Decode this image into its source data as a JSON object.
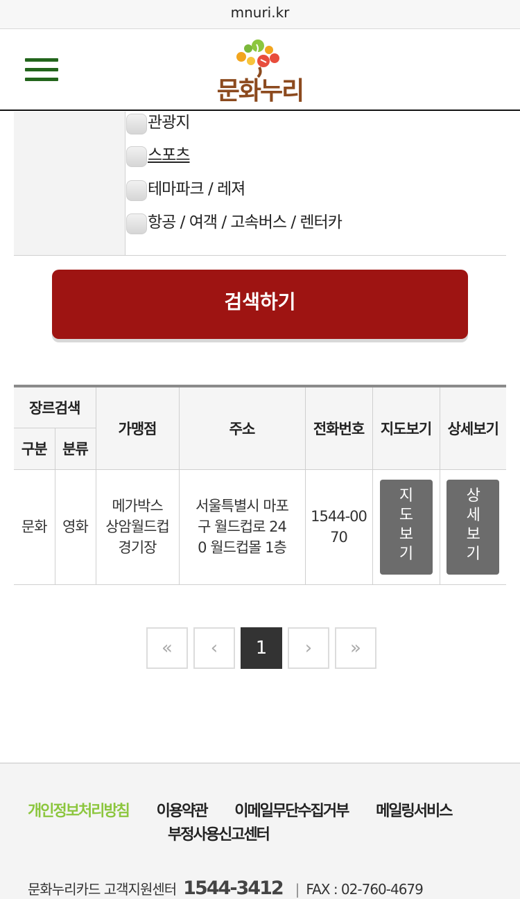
{
  "browser": {
    "url": "mnuri.kr"
  },
  "header": {
    "logo_text": "문화누리"
  },
  "filters": {
    "options": [
      {
        "label": "관광지"
      },
      {
        "label": "스포츠"
      },
      {
        "label": "테마파크 / 레져"
      },
      {
        "label": "항공 / 여객 / 고속버스 / 렌터카"
      }
    ]
  },
  "search_button": {
    "label": "검색하기"
  },
  "table": {
    "headers": {
      "genre_search": "장르검색",
      "category": "구분",
      "type": "분류",
      "store": "가맹점",
      "address": "주소",
      "phone": "전화번호",
      "map": "지도보기",
      "detail": "상세보기"
    },
    "rows": [
      {
        "category": "문화",
        "type": "영화",
        "store_lines": [
          "메가박스",
          "상암월드컵",
          "경기장"
        ],
        "address_lines": [
          "서울특별시 마포",
          "구 월드컵로 24",
          "0 월드컵몰 1층"
        ],
        "phone_lines": [
          "1544-00",
          "70"
        ],
        "map_btn": [
          "지",
          "도",
          "보",
          "기"
        ],
        "detail_btn": [
          "상",
          "세",
          "보",
          "기"
        ]
      }
    ]
  },
  "pagination": {
    "first": "«",
    "prev": "‹",
    "current": "1",
    "next": "›",
    "last": "»"
  },
  "footer": {
    "links": [
      "개인정보처리방침",
      "이용약관",
      "이메일무단수집거부",
      "메일링서비스",
      "부정사용신고센터"
    ],
    "center_label": "문화누리카드 고객지원센터",
    "phone": "1544-3412",
    "separator": "|",
    "fax": "FAX : 02-760-4679"
  },
  "colors": {
    "primary_button": "#9e1412",
    "menu_icon": "#23651c",
    "footer_highlight": "#8cc63e",
    "action_button": "#6c6c6c"
  }
}
